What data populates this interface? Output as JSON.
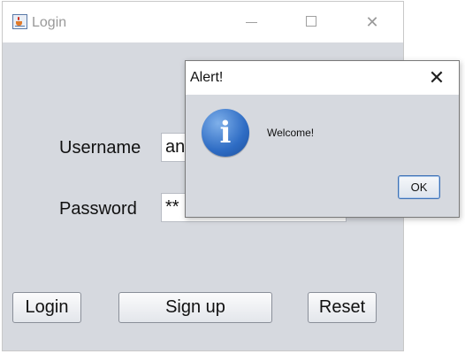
{
  "login_window": {
    "title": "Login",
    "icon": "java-cup-icon",
    "controls": {
      "minimize": "minimize-icon",
      "maximize": "maximize-icon",
      "close": "✕"
    },
    "username": {
      "label": "Username",
      "value": "anv"
    },
    "password": {
      "label": "Password",
      "value": "**"
    },
    "buttons": {
      "login": "Login",
      "signup": "Sign up",
      "reset": "Reset"
    }
  },
  "alert_dialog": {
    "title": "Alert!",
    "close": "✕",
    "icon": "info-icon",
    "icon_glyph": "i",
    "message": "Welcome!",
    "ok_label": "OK"
  },
  "colors": {
    "window_background": "#d6d9df",
    "titlebar": "#ffffff",
    "info_icon_blue": "#2e6cc4",
    "ok_button_border": "#3f72b5"
  }
}
